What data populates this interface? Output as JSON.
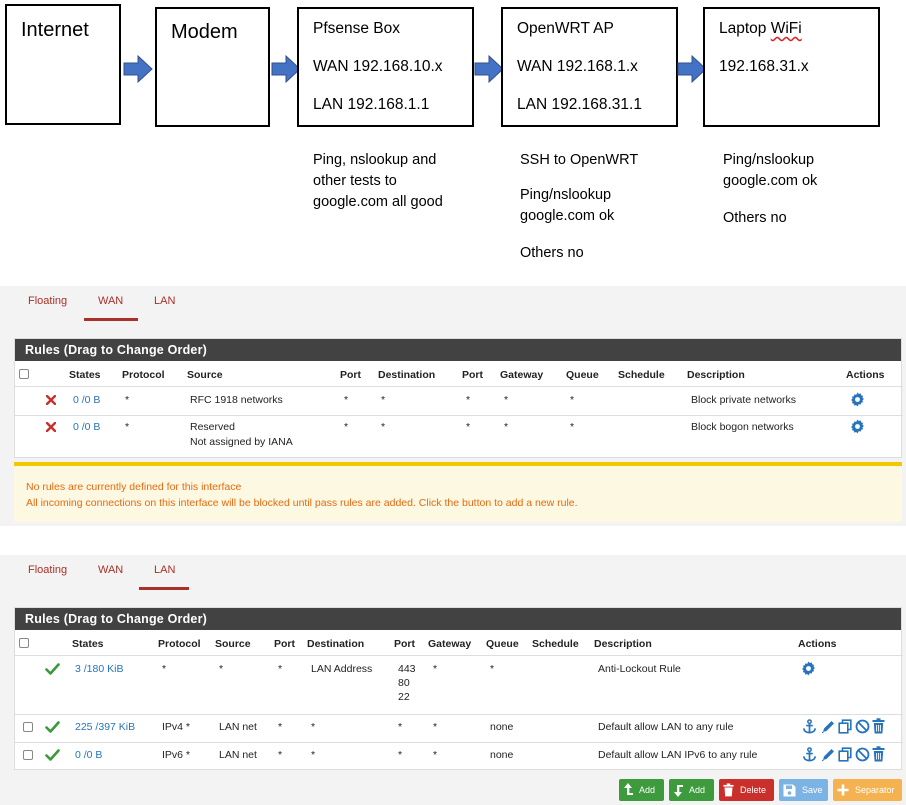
{
  "diagram": {
    "boxes": [
      {
        "title": "Internet",
        "lines": []
      },
      {
        "title": "Modem",
        "lines": []
      },
      {
        "title": "Pfsense Box",
        "lines": [
          "WAN 192.168.10.x",
          "LAN 192.168.1.1"
        ]
      },
      {
        "title": "OpenWRT AP",
        "lines": [
          "WAN 192.168.1.x",
          "LAN 192.168.31.1"
        ]
      },
      {
        "title_prefix": "Laptop ",
        "title_flag": "WiFi",
        "lines": [
          "192.168.31.x"
        ]
      }
    ],
    "notes": {
      "pfsense": [
        "Ping, nslookup and",
        "other tests to",
        "google.com all good"
      ],
      "openwrt": [
        "SSH to OpenWRT",
        "Ping/nslookup",
        "google.com ok",
        "Others no"
      ],
      "laptop": [
        "Ping/nslookup",
        "google.com ok",
        "Others no"
      ]
    }
  },
  "wan_panel": {
    "tabs": [
      "Floating",
      "WAN",
      "LAN"
    ],
    "active_tab": "WAN",
    "heading": "Rules (Drag to Change Order)",
    "columns": [
      "States",
      "Protocol",
      "Source",
      "Port",
      "Destination",
      "Port",
      "Gateway",
      "Queue",
      "Schedule",
      "Description",
      "Actions"
    ],
    "rows": [
      {
        "status": "block",
        "states": "0 /0 B",
        "protocol": "*",
        "source": "RFC 1918 networks",
        "source2": "",
        "port": "*",
        "destination": "*",
        "dport": "*",
        "gateway": "*",
        "queue": "*",
        "schedule": "",
        "description": "Block private networks"
      },
      {
        "status": "block",
        "states": "0 /0 B",
        "protocol": "*",
        "source": "Reserved",
        "source2": "Not assigned by IANA",
        "port": "*",
        "destination": "*",
        "dport": "*",
        "gateway": "*",
        "queue": "*",
        "schedule": "",
        "description": "Block bogon networks"
      }
    ],
    "warning": [
      "No rules are currently defined for this interface",
      "All incoming connections on this interface will be blocked until pass rules are added. Click the button to add a new rule."
    ]
  },
  "lan_panel": {
    "tabs": [
      "Floating",
      "WAN",
      "LAN"
    ],
    "active_tab": "LAN",
    "heading": "Rules (Drag to Change Order)",
    "columns": [
      "States",
      "Protocol",
      "Source",
      "Port",
      "Destination",
      "Port",
      "Gateway",
      "Queue",
      "Schedule",
      "Description",
      "Actions"
    ],
    "rows": [
      {
        "status": "pass",
        "states": "3 /180 KiB",
        "protocol": "*",
        "source": "*",
        "port": "*",
        "destination": "LAN Address",
        "dports": [
          "443",
          "80",
          "22"
        ],
        "gateway": "*",
        "queue": "*",
        "schedule": "",
        "description": "Anti-Lockout Rule"
      },
      {
        "status": "pass",
        "states": "225 /397 KiB",
        "protocol": "IPv4 *",
        "source": "LAN net",
        "port": "*",
        "destination": "*",
        "dports": [
          "*"
        ],
        "gateway": "*",
        "queue": "none",
        "schedule": "",
        "description": "Default allow LAN to any rule"
      },
      {
        "status": "pass",
        "states": "0 /0 B",
        "protocol": "IPv6 *",
        "source": "LAN net",
        "port": "*",
        "destination": "*",
        "dports": [
          "*"
        ],
        "gateway": "*",
        "queue": "none",
        "schedule": "",
        "description": "Default allow LAN IPv6 to any rule"
      }
    ],
    "buttons": {
      "add_top": "Add",
      "add_bottom": "Add",
      "delete": "Delete",
      "save": "Save",
      "separator": "Separator"
    }
  },
  "colors": {
    "brand_red": "#a8312a",
    "link_blue": "#2774bc",
    "pass_green": "#3a9a3a",
    "block_red": "#c9302c",
    "warning_orange": "#e46b12"
  }
}
